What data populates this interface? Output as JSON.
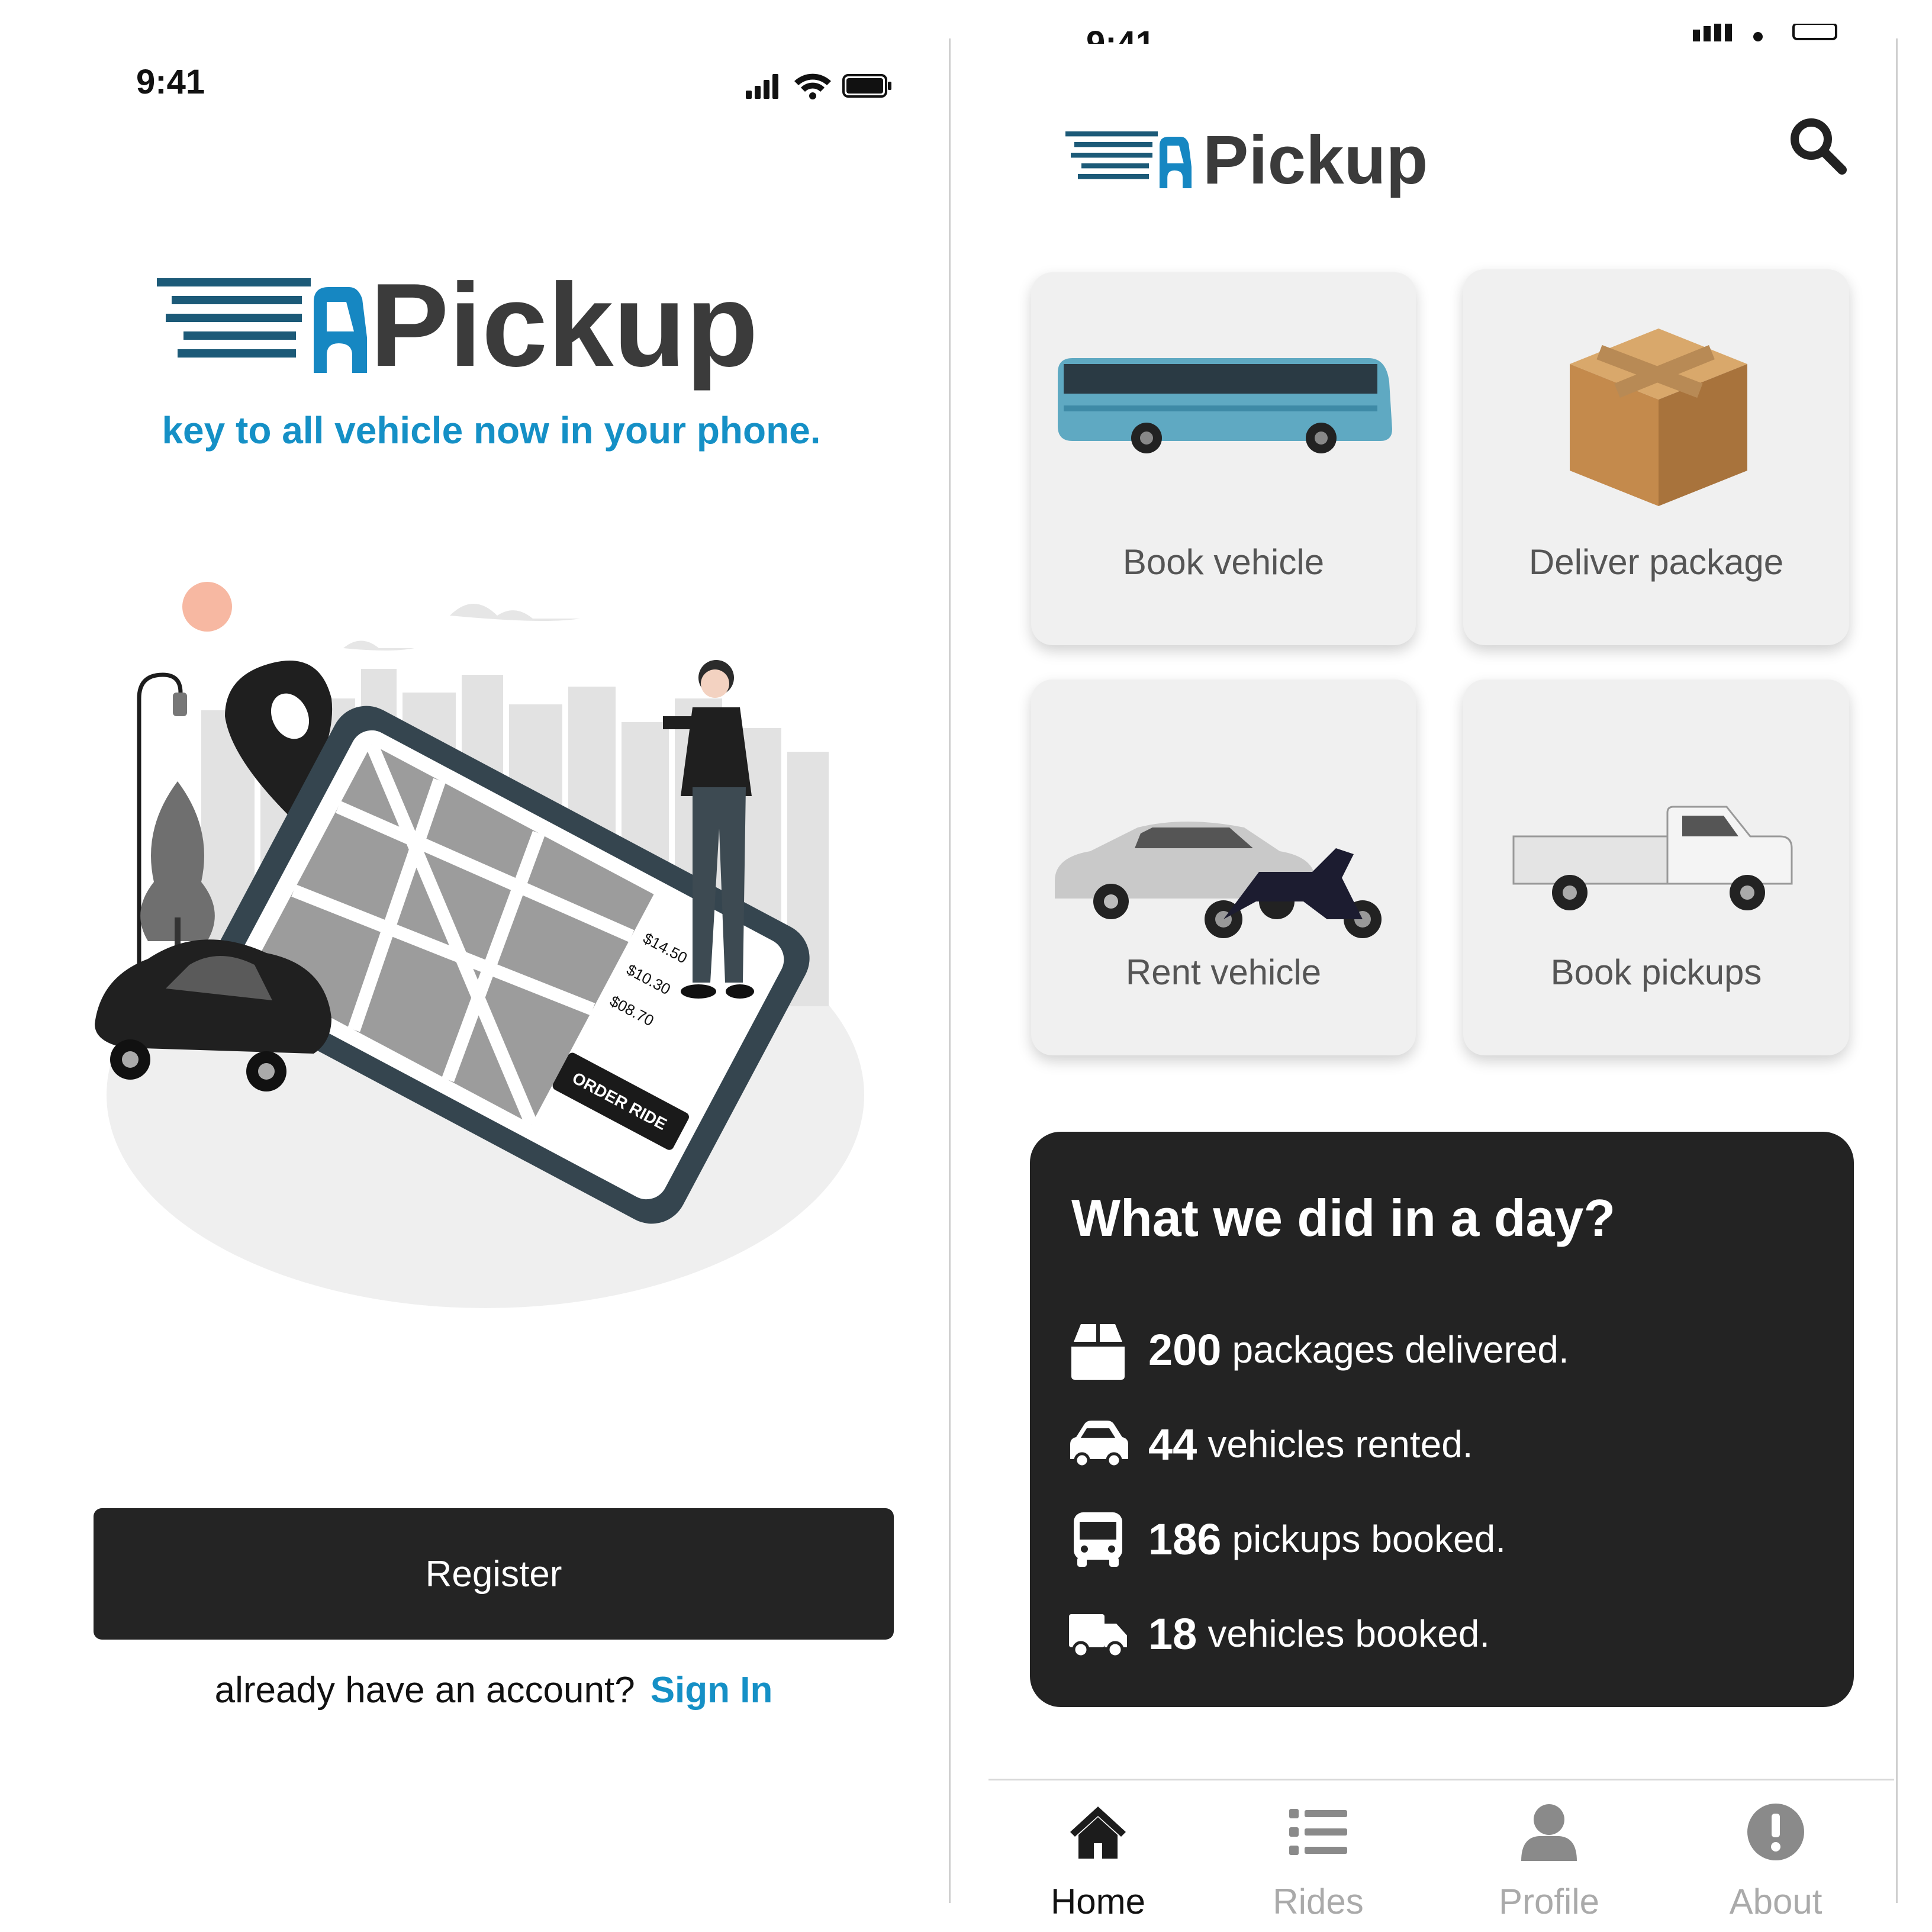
{
  "welcome": {
    "status_time": "9:41",
    "logo_text": "Pickup",
    "tagline": "key to all vehicle now in your phone.",
    "illustration": {
      "prices": [
        "$14.50",
        "$10.30",
        "$08.70"
      ],
      "order_button": "ORDER RIDE"
    },
    "register_label": "Register",
    "account_prompt": "already have an account?",
    "signin_label": "Sign In"
  },
  "home": {
    "logo_text": "Pickup",
    "services": [
      {
        "label": "Book vehicle",
        "icon": "bus-image"
      },
      {
        "label": "Deliver package",
        "icon": "package-box-image"
      },
      {
        "label": "Rent vehicle",
        "icon": "car-and-motorbike-image"
      },
      {
        "label": "Book pickups",
        "icon": "pickup-truck-image"
      }
    ],
    "stats": {
      "title": "What we did in a day?",
      "items": [
        {
          "value": "200",
          "text": "packages delivered.",
          "icon": "box-icon"
        },
        {
          "value": "44",
          "text": "vehicles rented.",
          "icon": "car-icon"
        },
        {
          "value": "186",
          "text": "pickups booked.",
          "icon": "bus-icon"
        },
        {
          "value": "18",
          "text": "vehicles booked.",
          "icon": "truck-icon"
        }
      ]
    },
    "tabs": [
      {
        "label": "Home",
        "icon": "home-icon",
        "active": true
      },
      {
        "label": "Rides",
        "icon": "list-icon",
        "active": false
      },
      {
        "label": "Profile",
        "icon": "user-icon",
        "active": false
      },
      {
        "label": "About",
        "icon": "info-icon",
        "active": false
      }
    ]
  },
  "colors": {
    "brand_blue": "#1590c6",
    "logo_navy": "#1c5a78",
    "dark": "#232323",
    "card_bg": "#f0f0f0"
  }
}
